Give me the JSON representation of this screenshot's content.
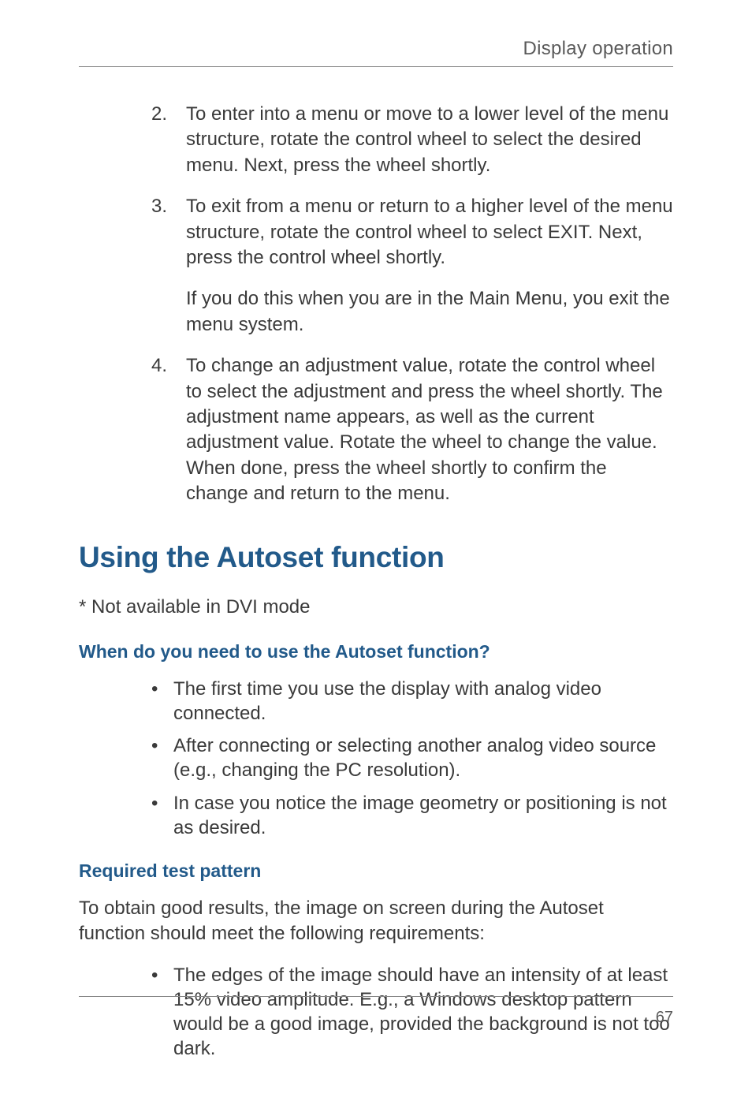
{
  "running_head": "Display operation",
  "ordered_list": [
    {
      "num": "2.",
      "text": "To enter into a menu or move to a lower level of the menu structure, rotate the control wheel to select the desired menu. Next, press the wheel shortly."
    },
    {
      "num": "3.",
      "text": "To exit from a menu or return to a higher level of the menu structure, rotate the control wheel to select EXIT. Next, press the control wheel shortly.",
      "sub": "If you do this when you are in the Main Menu, you exit the menu system."
    },
    {
      "num": "4.",
      "text": "To change an adjustment value, rotate the control wheel to select the adjustment and press the wheel shortly. The adjustment name appears, as well as the current adjustment value. Rotate the wheel to change the value. When done, press the wheel shortly to confirm the change and return to the menu."
    }
  ],
  "section_title": "Using the Autoset function",
  "asterisk_note": "* Not available in DVI mode",
  "subheading_1": "When do you need to use the Autoset function?",
  "bullets_1": [
    "The first time you use the display with analog video connected.",
    "After connecting or selecting another analog video source (e.g., changing the PC resolution).",
    "In case you notice the image geometry or positioning is not as desired."
  ],
  "subheading_2": "Required test pattern",
  "para_2": "To obtain good results, the image on screen during the Autoset function should meet the following requirements:",
  "bullets_2": [
    "The edges of the image should have an intensity of at least 15% video amplitude. E.g., a Windows desktop pattern would be a good image, provided the background is not too dark."
  ],
  "page_number": "67"
}
